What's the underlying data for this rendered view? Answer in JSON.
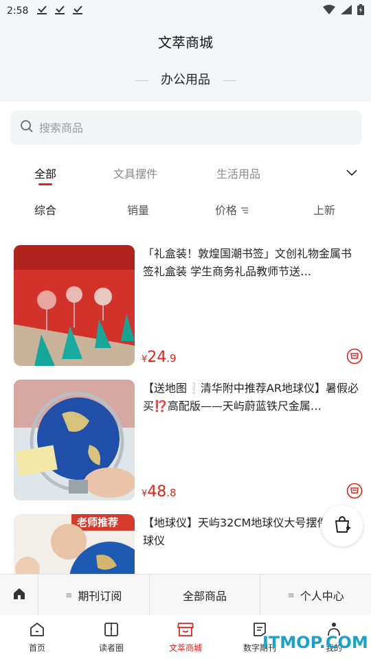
{
  "status": {
    "time": "2:58",
    "download_icons": [
      "download-done-icon",
      "download-done-icon",
      "download-done-icon"
    ]
  },
  "header": {
    "app_title": "文萃商城",
    "section_title": "办公用品"
  },
  "search": {
    "placeholder": "搜索商品"
  },
  "categories": [
    {
      "label": "全部",
      "active": true
    },
    {
      "label": "文具摆件",
      "active": false
    },
    {
      "label": "生活用品",
      "active": false
    }
  ],
  "sorts": [
    {
      "label": "综合",
      "active": true
    },
    {
      "label": "销量",
      "active": false
    },
    {
      "label": "价格",
      "active": false,
      "icon": "filter-icon"
    },
    {
      "label": "上新",
      "active": false
    }
  ],
  "products": [
    {
      "title": "「礼盒装！敦煌国潮书签」文创礼物金属书签礼盒装 学生商务礼品教师节送…",
      "price_symbol": "¥",
      "price_int": "24",
      "price_dec": ".9"
    },
    {
      "title": "【送地图❕清华附中推荐AR地球仪】暑假必买⁉️高配版——天屿蔚蓝铁尺金属…",
      "price_symbol": "¥",
      "price_int": "48",
      "price_dec": ".8"
    },
    {
      "title": "【地球仪】天屿32CM地球仪大号摆件AR地球仪",
      "badge": "老师推荐"
    }
  ],
  "subnav": {
    "items": [
      "期刊订阅",
      "全部商品",
      "个人中心"
    ]
  },
  "tabbar": [
    {
      "label": "首页",
      "icon": "home-icon",
      "active": false
    },
    {
      "label": "读者圈",
      "icon": "book-icon",
      "active": false
    },
    {
      "label": "文萃商城",
      "icon": "shop-icon",
      "active": true
    },
    {
      "label": "数字期刊",
      "icon": "document-icon",
      "active": false
    },
    {
      "label": "我的",
      "icon": "user-icon",
      "active": false
    }
  ],
  "watermark": "ITMOP.COM",
  "colors": {
    "accent": "#e2231a",
    "header_bg": "#f4f5f7",
    "search_bg": "#f3f4f6",
    "watermark": "#1aa3c8"
  }
}
